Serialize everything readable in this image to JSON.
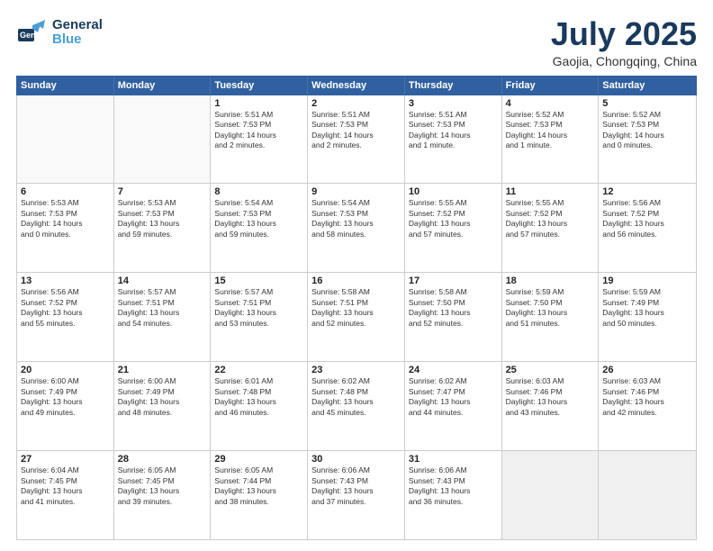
{
  "header": {
    "logo_line1": "General",
    "logo_line2": "Blue",
    "month": "July 2025",
    "location": "Gaojia, Chongqing, China"
  },
  "weekdays": [
    "Sunday",
    "Monday",
    "Tuesday",
    "Wednesday",
    "Thursday",
    "Friday",
    "Saturday"
  ],
  "rows": [
    [
      {
        "day": "",
        "empty": true
      },
      {
        "day": "",
        "empty": true
      },
      {
        "day": "1",
        "info": "Sunrise: 5:51 AM\nSunset: 7:53 PM\nDaylight: 14 hours\nand 2 minutes."
      },
      {
        "day": "2",
        "info": "Sunrise: 5:51 AM\nSunset: 7:53 PM\nDaylight: 14 hours\nand 2 minutes."
      },
      {
        "day": "3",
        "info": "Sunrise: 5:51 AM\nSunset: 7:53 PM\nDaylight: 14 hours\nand 1 minute."
      },
      {
        "day": "4",
        "info": "Sunrise: 5:52 AM\nSunset: 7:53 PM\nDaylight: 14 hours\nand 1 minute."
      },
      {
        "day": "5",
        "info": "Sunrise: 5:52 AM\nSunset: 7:53 PM\nDaylight: 14 hours\nand 0 minutes."
      }
    ],
    [
      {
        "day": "6",
        "info": "Sunrise: 5:53 AM\nSunset: 7:53 PM\nDaylight: 14 hours\nand 0 minutes."
      },
      {
        "day": "7",
        "info": "Sunrise: 5:53 AM\nSunset: 7:53 PM\nDaylight: 13 hours\nand 59 minutes."
      },
      {
        "day": "8",
        "info": "Sunrise: 5:54 AM\nSunset: 7:53 PM\nDaylight: 13 hours\nand 59 minutes."
      },
      {
        "day": "9",
        "info": "Sunrise: 5:54 AM\nSunset: 7:53 PM\nDaylight: 13 hours\nand 58 minutes."
      },
      {
        "day": "10",
        "info": "Sunrise: 5:55 AM\nSunset: 7:52 PM\nDaylight: 13 hours\nand 57 minutes."
      },
      {
        "day": "11",
        "info": "Sunrise: 5:55 AM\nSunset: 7:52 PM\nDaylight: 13 hours\nand 57 minutes."
      },
      {
        "day": "12",
        "info": "Sunrise: 5:56 AM\nSunset: 7:52 PM\nDaylight: 13 hours\nand 56 minutes."
      }
    ],
    [
      {
        "day": "13",
        "info": "Sunrise: 5:56 AM\nSunset: 7:52 PM\nDaylight: 13 hours\nand 55 minutes."
      },
      {
        "day": "14",
        "info": "Sunrise: 5:57 AM\nSunset: 7:51 PM\nDaylight: 13 hours\nand 54 minutes."
      },
      {
        "day": "15",
        "info": "Sunrise: 5:57 AM\nSunset: 7:51 PM\nDaylight: 13 hours\nand 53 minutes."
      },
      {
        "day": "16",
        "info": "Sunrise: 5:58 AM\nSunset: 7:51 PM\nDaylight: 13 hours\nand 52 minutes."
      },
      {
        "day": "17",
        "info": "Sunrise: 5:58 AM\nSunset: 7:50 PM\nDaylight: 13 hours\nand 52 minutes."
      },
      {
        "day": "18",
        "info": "Sunrise: 5:59 AM\nSunset: 7:50 PM\nDaylight: 13 hours\nand 51 minutes."
      },
      {
        "day": "19",
        "info": "Sunrise: 5:59 AM\nSunset: 7:49 PM\nDaylight: 13 hours\nand 50 minutes."
      }
    ],
    [
      {
        "day": "20",
        "info": "Sunrise: 6:00 AM\nSunset: 7:49 PM\nDaylight: 13 hours\nand 49 minutes."
      },
      {
        "day": "21",
        "info": "Sunrise: 6:00 AM\nSunset: 7:49 PM\nDaylight: 13 hours\nand 48 minutes."
      },
      {
        "day": "22",
        "info": "Sunrise: 6:01 AM\nSunset: 7:48 PM\nDaylight: 13 hours\nand 46 minutes."
      },
      {
        "day": "23",
        "info": "Sunrise: 6:02 AM\nSunset: 7:48 PM\nDaylight: 13 hours\nand 45 minutes."
      },
      {
        "day": "24",
        "info": "Sunrise: 6:02 AM\nSunset: 7:47 PM\nDaylight: 13 hours\nand 44 minutes."
      },
      {
        "day": "25",
        "info": "Sunrise: 6:03 AM\nSunset: 7:46 PM\nDaylight: 13 hours\nand 43 minutes."
      },
      {
        "day": "26",
        "info": "Sunrise: 6:03 AM\nSunset: 7:46 PM\nDaylight: 13 hours\nand 42 minutes."
      }
    ],
    [
      {
        "day": "27",
        "info": "Sunrise: 6:04 AM\nSunset: 7:45 PM\nDaylight: 13 hours\nand 41 minutes."
      },
      {
        "day": "28",
        "info": "Sunrise: 6:05 AM\nSunset: 7:45 PM\nDaylight: 13 hours\nand 39 minutes."
      },
      {
        "day": "29",
        "info": "Sunrise: 6:05 AM\nSunset: 7:44 PM\nDaylight: 13 hours\nand 38 minutes."
      },
      {
        "day": "30",
        "info": "Sunrise: 6:06 AM\nSunset: 7:43 PM\nDaylight: 13 hours\nand 37 minutes."
      },
      {
        "day": "31",
        "info": "Sunrise: 6:06 AM\nSunset: 7:43 PM\nDaylight: 13 hours\nand 36 minutes."
      },
      {
        "day": "",
        "empty": true,
        "shaded": true
      },
      {
        "day": "",
        "empty": true,
        "shaded": true
      }
    ]
  ]
}
